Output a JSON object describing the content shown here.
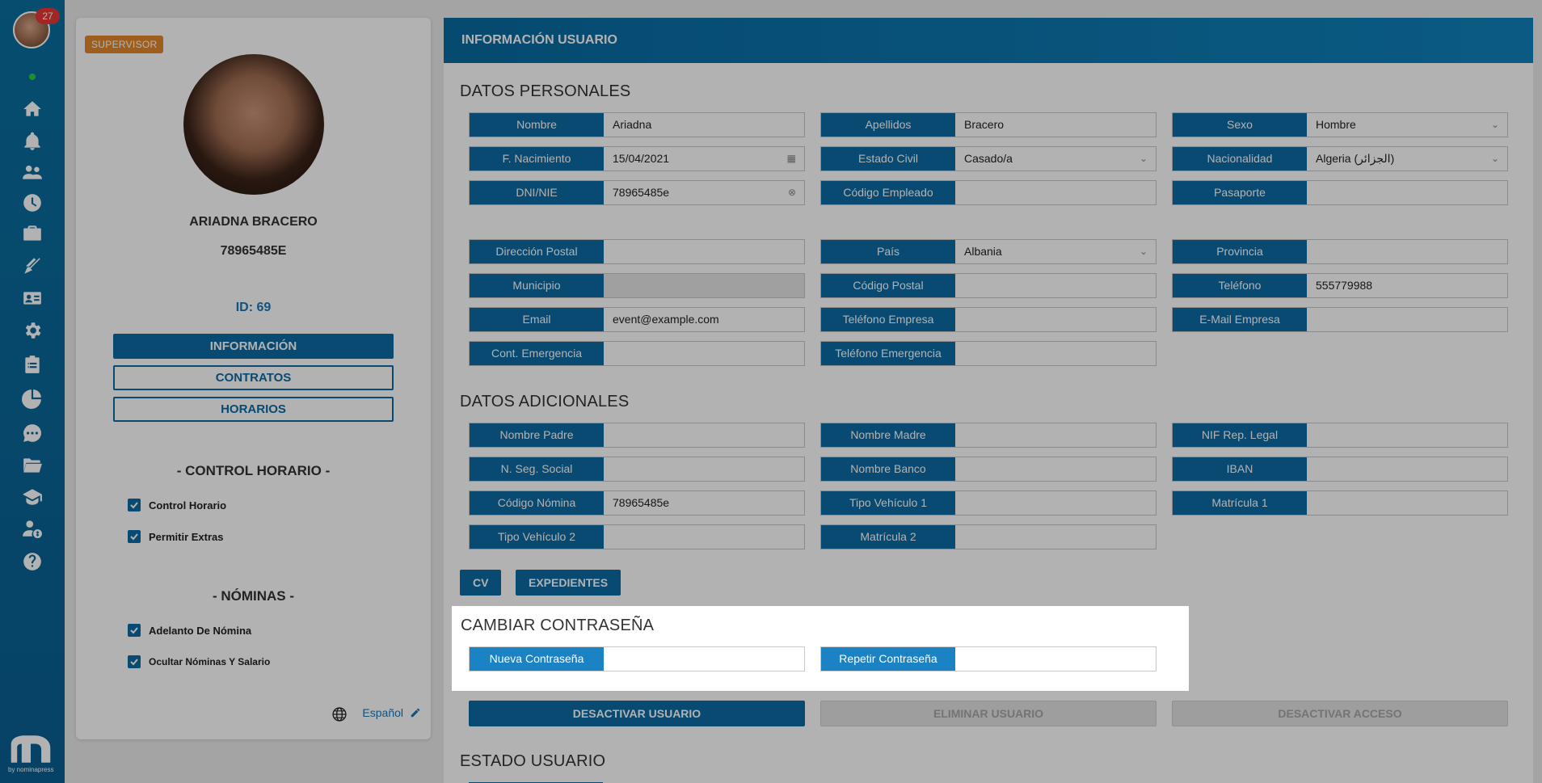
{
  "rail": {
    "badge_count": "27",
    "logo_caption": "by nominapress",
    "icons": [
      "home-icon",
      "bell-icon",
      "users-icon",
      "clock-icon",
      "briefcase-icon",
      "tools-icon",
      "id-card-icon",
      "gear-icon",
      "clipboard-icon",
      "pie-chart-icon",
      "chat-icon",
      "folder-icon",
      "graduation-cap-icon",
      "user-money-icon",
      "help-icon"
    ]
  },
  "profile": {
    "role_badge": "SUPERVISOR",
    "name": "ARIADNA BRACERO",
    "dni": "78965485E",
    "id_label": "ID: 69",
    "buttons": {
      "info": "INFORMACIÓN",
      "contracts": "CONTRATOS",
      "schedules": "HORARIOS"
    },
    "control_title": "- CONTROL HORARIO -",
    "control_items": [
      "Control Horario",
      "Permitir Extras"
    ],
    "payroll_title": "- NÓMINAS -",
    "payroll_items": [
      "Adelanto De Nómina",
      "Ocultar Nóminas Y Salario"
    ],
    "language": "Español"
  },
  "main": {
    "header_title": "INFORMACIÓN USUARIO",
    "personal_title": "DATOS PERSONALES",
    "additional_title": "DATOS ADICIONALES",
    "password_title": "CAMBIAR CONTRASEÑA",
    "status_title": "ESTADO USUARIO",
    "personal": {
      "nombre": {
        "label": "Nombre",
        "value": "Ariadna"
      },
      "apellidos": {
        "label": "Apellidos",
        "value": "Bracero"
      },
      "sexo": {
        "label": "Sexo",
        "value": "Hombre"
      },
      "nacimiento": {
        "label": "F. Nacimiento",
        "value": "15/04/2021"
      },
      "estado_civil": {
        "label": "Estado Civil",
        "value": "Casado/a"
      },
      "nacionalidad": {
        "label": "Nacionalidad",
        "value": "Algeria (الجزائر)"
      },
      "dni": {
        "label": "DNI/NIE",
        "value": "78965485e"
      },
      "codigo_empleado": {
        "label": "Código Empleado",
        "value": ""
      },
      "pasaporte": {
        "label": "Pasaporte",
        "value": ""
      },
      "direccion": {
        "label": "Dirección Postal",
        "value": ""
      },
      "pais": {
        "label": "País",
        "value": "Albania"
      },
      "provincia": {
        "label": "Provincia",
        "value": ""
      },
      "municipio": {
        "label": "Municipio",
        "value": ""
      },
      "codigo_postal": {
        "label": "Código Postal",
        "value": ""
      },
      "telefono": {
        "label": "Teléfono",
        "value": "555779988"
      },
      "email": {
        "label": "Email",
        "value": "event@example.com"
      },
      "telefono_empresa": {
        "label": "Teléfono Empresa",
        "value": ""
      },
      "email_empresa": {
        "label": "E-Mail Empresa",
        "value": ""
      },
      "cont_emergencia": {
        "label": "Cont. Emergencia",
        "value": ""
      },
      "telefono_emergencia": {
        "label": "Teléfono Emergencia",
        "value": ""
      }
    },
    "additional": {
      "nombre_padre": {
        "label": "Nombre Padre",
        "value": ""
      },
      "nombre_madre": {
        "label": "Nombre Madre",
        "value": ""
      },
      "nif_rep": {
        "label": "NIF Rep. Legal",
        "value": ""
      },
      "seg_social": {
        "label": "N. Seg. Social",
        "value": ""
      },
      "nombre_banco": {
        "label": "Nombre Banco",
        "value": ""
      },
      "iban": {
        "label": "IBAN",
        "value": ""
      },
      "codigo_nomina": {
        "label": "Código Nómina",
        "value": "78965485e"
      },
      "tipo_vehiculo_1": {
        "label": "Tipo Vehículo 1",
        "value": ""
      },
      "matricula_1": {
        "label": "Matrícula 1",
        "value": ""
      },
      "tipo_vehiculo_2": {
        "label": "Tipo Vehículo 2",
        "value": ""
      },
      "matricula_2": {
        "label": "Matrícula 2",
        "value": ""
      }
    },
    "doc_buttons": {
      "cv": "CV",
      "expedientes": "EXPEDIENTES"
    },
    "password": {
      "nueva": {
        "label": "Nueva Contraseña",
        "value": ""
      },
      "repetir": {
        "label": "Repetir Contraseña",
        "value": ""
      }
    },
    "actions": {
      "deactivate_user": "DESACTIVAR USUARIO",
      "delete_user": "ELIMINAR USUARIO",
      "deactivate_access": "DESACTIVAR ACCESO"
    }
  },
  "colors": {
    "primary": "#0c6aa3",
    "badge": "#e2892b",
    "notify": "#e53935",
    "online": "#2ecc40"
  }
}
